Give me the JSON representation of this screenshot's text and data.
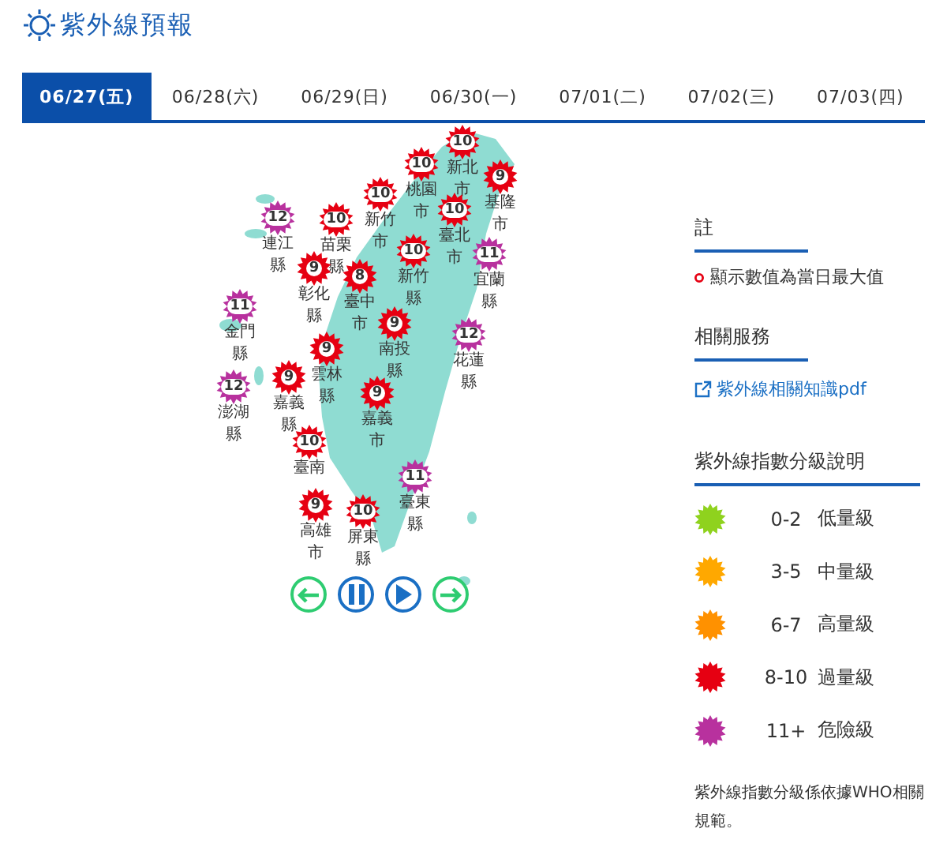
{
  "header": {
    "title": "紫外線預報"
  },
  "tabs": [
    {
      "label": "06/27(五)",
      "selected": true
    },
    {
      "label": "06/28(六)",
      "selected": false
    },
    {
      "label": "06/29(日)",
      "selected": false
    },
    {
      "label": "06/30(一)",
      "selected": false
    },
    {
      "label": "07/01(二)",
      "selected": false
    },
    {
      "label": "07/02(三)",
      "selected": false
    },
    {
      "label": "07/03(四)",
      "selected": false
    }
  ],
  "map": {
    "stations": [
      {
        "name": "新北市",
        "value": "10",
        "color": "#e60012"
      },
      {
        "name": "基隆市",
        "value": "9",
        "color": "#e60012"
      },
      {
        "name": "桃園市",
        "value": "10",
        "color": "#e60012"
      },
      {
        "name": "新竹市",
        "value": "10",
        "color": "#e60012"
      },
      {
        "name": "臺北市",
        "value": "10",
        "color": "#e60012"
      },
      {
        "name": "連江縣",
        "value": "12",
        "color": "#b8319e"
      },
      {
        "name": "苗栗縣",
        "value": "10",
        "color": "#e60012"
      },
      {
        "name": "新竹縣",
        "value": "10",
        "color": "#e60012"
      },
      {
        "name": "宜蘭縣",
        "value": "11",
        "color": "#b8319e"
      },
      {
        "name": "彰化縣",
        "value": "9",
        "color": "#e60012"
      },
      {
        "name": "臺中市",
        "value": "8",
        "color": "#e60012"
      },
      {
        "name": "金門縣",
        "value": "11",
        "color": "#b8319e"
      },
      {
        "name": "雲林縣",
        "value": "9",
        "color": "#e60012"
      },
      {
        "name": "南投縣",
        "value": "9",
        "color": "#e60012"
      },
      {
        "name": "花蓮縣",
        "value": "12",
        "color": "#b8319e"
      },
      {
        "name": "澎湖縣",
        "value": "12",
        "color": "#b8319e"
      },
      {
        "name": "嘉義縣",
        "value": "9",
        "color": "#e60012"
      },
      {
        "name": "嘉義市",
        "value": "9",
        "color": "#e60012"
      },
      {
        "name": "臺南",
        "value": "10",
        "color": "#e60012"
      },
      {
        "name": "臺東縣",
        "value": "11",
        "color": "#b8319e"
      },
      {
        "name": "高雄市",
        "value": "9",
        "color": "#e60012"
      },
      {
        "name": "屏東縣",
        "value": "10",
        "color": "#e60012"
      }
    ],
    "controls": [
      {
        "kind": "prev"
      },
      {
        "kind": "pause"
      },
      {
        "kind": "play"
      },
      {
        "kind": "next"
      }
    ]
  },
  "note": {
    "heading": "註",
    "text": "顯示數值為當日最大值"
  },
  "services": {
    "heading": "相關服務",
    "link": "紫外線相關知識pdf"
  },
  "legend": {
    "heading": "紫外線指數分級說明",
    "items": [
      {
        "range": "0-2",
        "label": "低量級",
        "color": "#8fd21e"
      },
      {
        "range": "3-5",
        "label": "中量級",
        "color": "#ffa800"
      },
      {
        "range": "6-7",
        "label": "高量級",
        "color": "#ff9100"
      },
      {
        "range": "8-10",
        "label": "過量級",
        "color": "#e60012"
      },
      {
        "range": "11+",
        "label": "危險級",
        "color": "#b8319e"
      }
    ],
    "footnote": "紫外線指數分級係依據WHO相關規範。"
  }
}
